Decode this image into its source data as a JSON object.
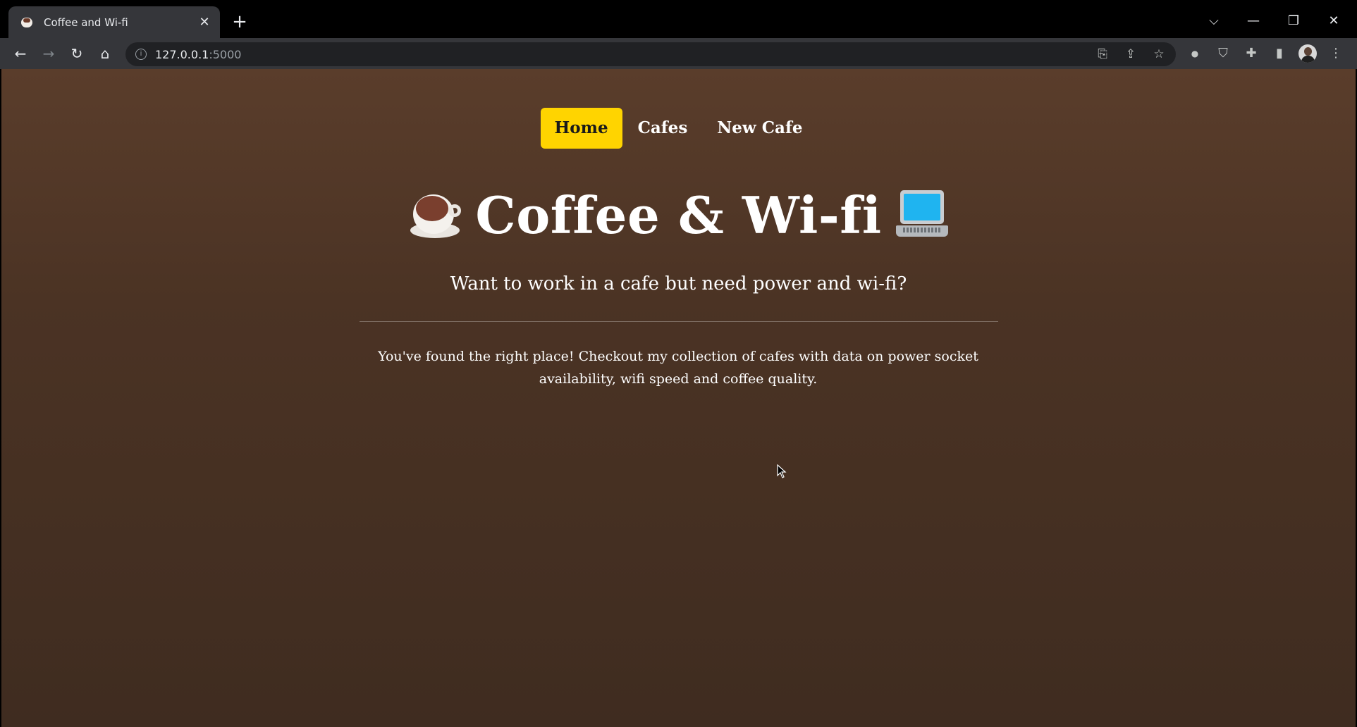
{
  "browser": {
    "tab": {
      "title": "Coffee and Wi-fi",
      "close": "✕"
    },
    "new_tab": "+",
    "window_controls": {
      "menu": "⌵",
      "minimize": "—",
      "restore": "❐",
      "close": "✕"
    },
    "nav_buttons": {
      "back": "←",
      "forward": "→",
      "reload": "↻",
      "home": "⌂"
    },
    "address": {
      "info": "i",
      "host": "127.0.0.1",
      "port": ":5000"
    },
    "omnibox_icons": {
      "translate": "⎘",
      "share": "⇪",
      "bookmark": "☆"
    },
    "extension_icons": {
      "ext1": "●",
      "ext2": "⛉",
      "extensions": "✚",
      "side_panel": "▮",
      "menu": "⋮"
    }
  },
  "page": {
    "nav": {
      "home": "Home",
      "cafes": "Cafes",
      "new_cafe": "New Cafe"
    },
    "title": "Coffee & Wi-fi",
    "subtitle": "Want to work in a cafe but need power and wi-fi?",
    "description": "You've found the right place! Checkout my collection of cafes with data on power socket availability, wifi speed and coffee quality.",
    "colors": {
      "accent": "#ffd400",
      "background_top": "#5a3d2b",
      "background_bottom": "#3f2c20"
    }
  }
}
